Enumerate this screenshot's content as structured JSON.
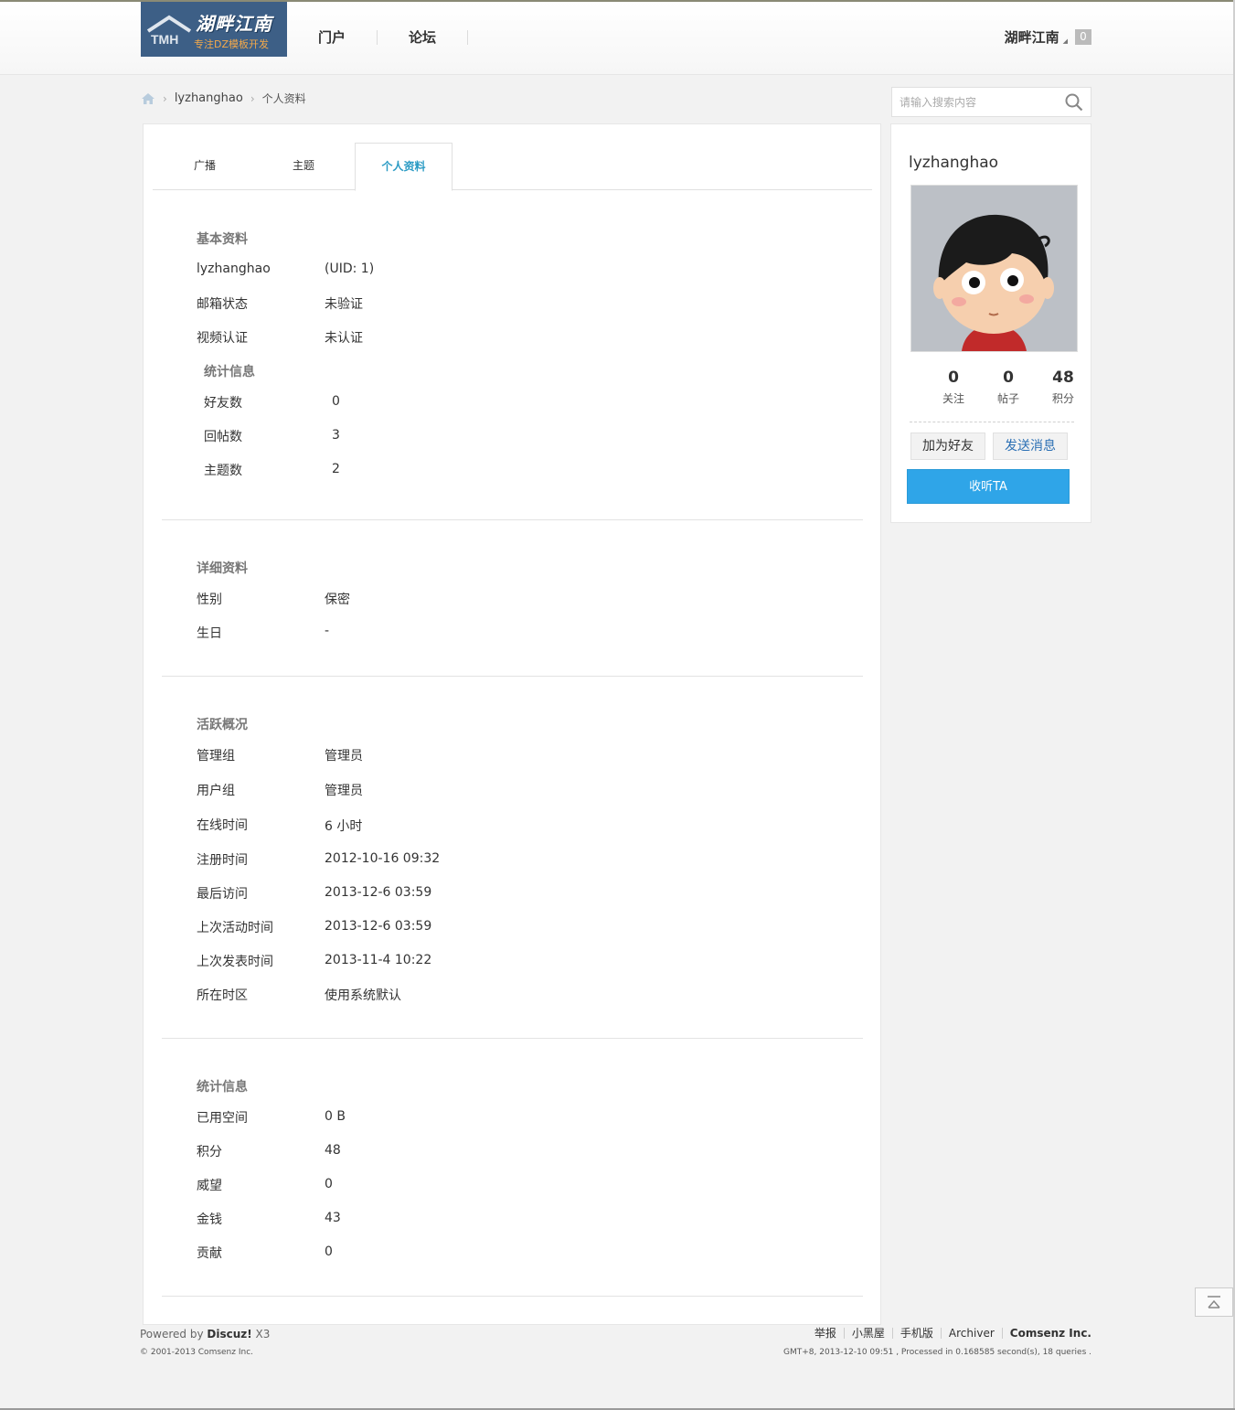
{
  "header": {
    "logo_title": "湖畔江南",
    "logo_subtitle": "专注DZ模板开发",
    "logo_letters": "TMH",
    "nav": [
      {
        "label": "门户"
      },
      {
        "label": "论坛"
      }
    ],
    "user_name": "湖畔江南",
    "notice_count": "0"
  },
  "breadcrumb": {
    "items": [
      "lyzhanghao",
      "个人资料"
    ]
  },
  "search": {
    "placeholder": "请输入搜索内容"
  },
  "tabs": [
    {
      "label": "广播",
      "active": false
    },
    {
      "label": "主题",
      "active": false
    },
    {
      "label": "个人资料",
      "active": true
    }
  ],
  "basic": {
    "title": "基本资料",
    "username": "lyzhanghao",
    "uid": "(UID: 1)",
    "rows": [
      {
        "label": "邮箱状态",
        "value": "未验证"
      },
      {
        "label": "视频认证",
        "value": "未认证"
      }
    ],
    "stats_title": "统计信息",
    "stats": [
      {
        "label": "好友数",
        "value": "0"
      },
      {
        "label": "回帖数",
        "value": "3"
      },
      {
        "label": "主题数",
        "value": "2"
      }
    ]
  },
  "detail": {
    "title": "详细资料",
    "rows": [
      {
        "label": "性别",
        "value": "保密"
      },
      {
        "label": "生日",
        "value": "-"
      }
    ]
  },
  "activity": {
    "title": "活跃概况",
    "rows": [
      {
        "label": "管理组",
        "value": "管理员"
      },
      {
        "label": "用户组",
        "value": "管理员"
      },
      {
        "label": "在线时间",
        "value": "6 小时"
      },
      {
        "label": "注册时间",
        "value": "2012-10-16 09:32"
      },
      {
        "label": "最后访问",
        "value": "2013-12-6 03:59"
      },
      {
        "label": "上次活动时间",
        "value": "2013-12-6 03:59"
      },
      {
        "label": "上次发表时间",
        "value": "2013-11-4 10:22"
      },
      {
        "label": "所在时区",
        "value": "使用系统默认"
      }
    ]
  },
  "statistics": {
    "title": "统计信息",
    "rows": [
      {
        "label": "已用空间",
        "value": "0 B"
      },
      {
        "label": "积分",
        "value": "48"
      },
      {
        "label": "威望",
        "value": "0"
      },
      {
        "label": "金钱",
        "value": "43"
      },
      {
        "label": "贡献",
        "value": "0"
      }
    ]
  },
  "side": {
    "username": "lyzhanghao",
    "stats": [
      {
        "num": "0",
        "label": "关注"
      },
      {
        "num": "0",
        "label": "帖子"
      },
      {
        "num": "48",
        "label": "积分"
      }
    ],
    "add_friend": "加为好友",
    "send_message": "发送消息",
    "follow": "收听TA"
  },
  "footer": {
    "powered_prefix": "Powered by ",
    "powered_brand": "Discuz!",
    "powered_version": " X3",
    "copyright": "© 2001-2013 Comsenz Inc.",
    "links": [
      "举报",
      "小黑屋",
      "手机版",
      "Archiver",
      "Comsenz Inc."
    ],
    "stat_text": "GMT+8, 2013-12-10 09:51 , Processed in 0.168585 second(s), 18 queries ."
  },
  "colors": {
    "accent": "#2fa5e8",
    "tab_active": "#2b9bc4",
    "logo_bg": "#3d5f86"
  }
}
